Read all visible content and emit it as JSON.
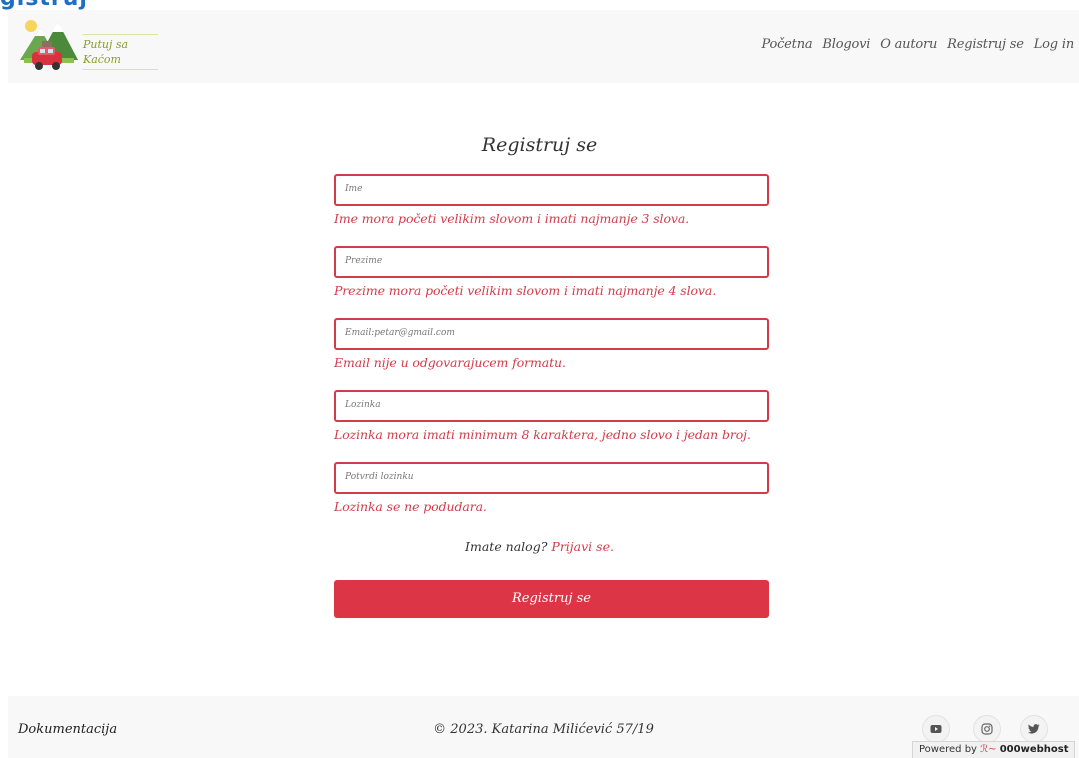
{
  "top_strip": {
    "text": "gistruj"
  },
  "header": {
    "brand": "Putuj sa Kaćom",
    "nav": [
      {
        "label": "Početna"
      },
      {
        "label": "Blogovi"
      },
      {
        "label": "O autoru"
      },
      {
        "label": "Registruj se"
      },
      {
        "label": "Log in"
      }
    ]
  },
  "form": {
    "title": "Registruj se",
    "fields": [
      {
        "placeholder": "Ime",
        "error": "Ime mora početi velikim slovom i imati najmanje 3 slova."
      },
      {
        "placeholder": "Prezime",
        "error": "Prezime mora početi velikim slovom i imati najmanje 4 slova."
      },
      {
        "placeholder": "Email:petar@gmail.com",
        "error": "Email nije u odgovarajucem formatu."
      },
      {
        "placeholder": "Lozinka",
        "error": "Lozinka mora imati minimum 8 karaktera, jedno slovo i jedan broj."
      },
      {
        "placeholder": "Potvrdi lozinku",
        "error": "Lozinka se ne podudara."
      }
    ],
    "login_prompt": "Imate nalog?",
    "login_link": "Prijavi se.",
    "submit_label": "Registruj se"
  },
  "footer": {
    "documentation": "Dokumentacija",
    "copyright": "© 2023. Katarina Milićević 57/19",
    "social_icons": [
      "youtube-icon",
      "instagram-icon",
      "twitter-icon"
    ]
  },
  "badge": {
    "prefix": "Powered by",
    "host": "000webhost"
  },
  "colors": {
    "accent": "#dc3545",
    "error": "#d33b4a",
    "navbar_bg": "#f8f8f8",
    "brand": "#8a9d2a"
  }
}
